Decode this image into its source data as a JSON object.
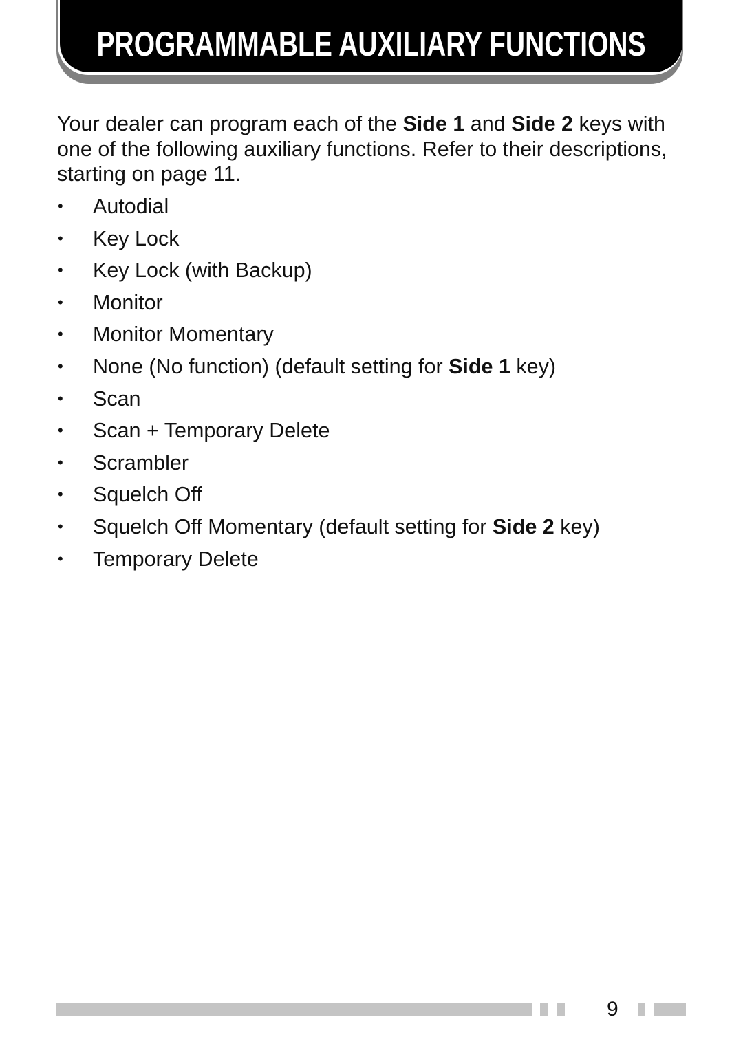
{
  "header": {
    "title": "PROGRAMMABLE AUXILIARY FUNCTIONS"
  },
  "intro": {
    "part1": "Your dealer can program each of the ",
    "key1": "Side 1",
    "part2": " and ",
    "key2": "Side 2",
    "part3": " keys with one of the following auxiliary functions.  Refer to their descriptions, starting on page 11."
  },
  "functions": {
    "bullet": "•",
    "items": [
      {
        "text": "Autodial"
      },
      {
        "text": "Key Lock"
      },
      {
        "text": "Key Lock (with Backup)"
      },
      {
        "text": "Monitor"
      },
      {
        "text": "Monitor Momentary"
      },
      {
        "text": "None (No function) (default setting for ",
        "bold": "Side 1",
        "suffix": " key)"
      },
      {
        "text": "Scan"
      },
      {
        "text": "Scan + Temporary Delete"
      },
      {
        "text": "Scrambler"
      },
      {
        "text": "Squelch Off"
      },
      {
        "text": "Squelch Off Momentary (default setting for ",
        "bold": "Side 2",
        "suffix": " key)"
      },
      {
        "text": "Temporary Delete"
      }
    ]
  },
  "footer": {
    "page_number": "9"
  },
  "colors": {
    "header_bg": "#000000",
    "header_text": "#ffffff",
    "header_shadow": "#808080",
    "footer_bar": "#c4c4c4",
    "text": "#111111"
  }
}
